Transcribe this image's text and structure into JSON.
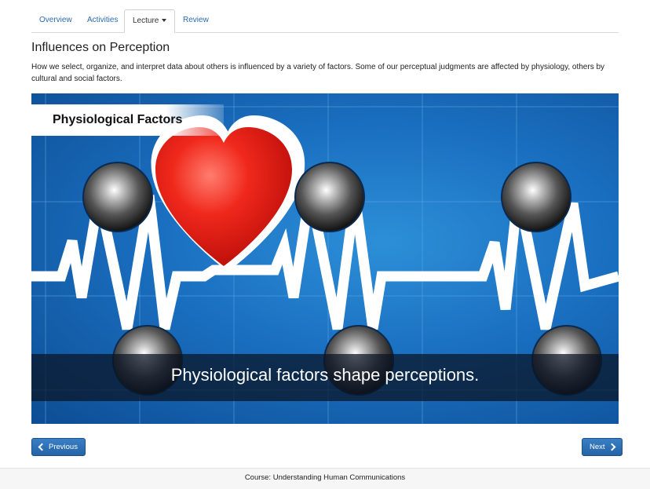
{
  "tabs": [
    {
      "label": "Overview"
    },
    {
      "label": "Activities"
    },
    {
      "label": "Lecture"
    },
    {
      "label": "Review"
    }
  ],
  "page": {
    "title": "Influences on Perception",
    "intro": "How we select, organize, and interpret data about others is influenced by a variety of factors. Some of our perceptual judgments are affected by physiology, others by cultural and social factors."
  },
  "video": {
    "banner": "Physiological Factors",
    "caption": "Physiological factors shape perceptions."
  },
  "nav": {
    "previous": "Previous",
    "next": "Next"
  },
  "footer": {
    "course": "Course: Understanding Human Communications"
  },
  "colors": {
    "accent": "#2a6ab0",
    "button": "#2563a8",
    "heart": "#e8261c",
    "video_bg": "#1a6fc0"
  }
}
